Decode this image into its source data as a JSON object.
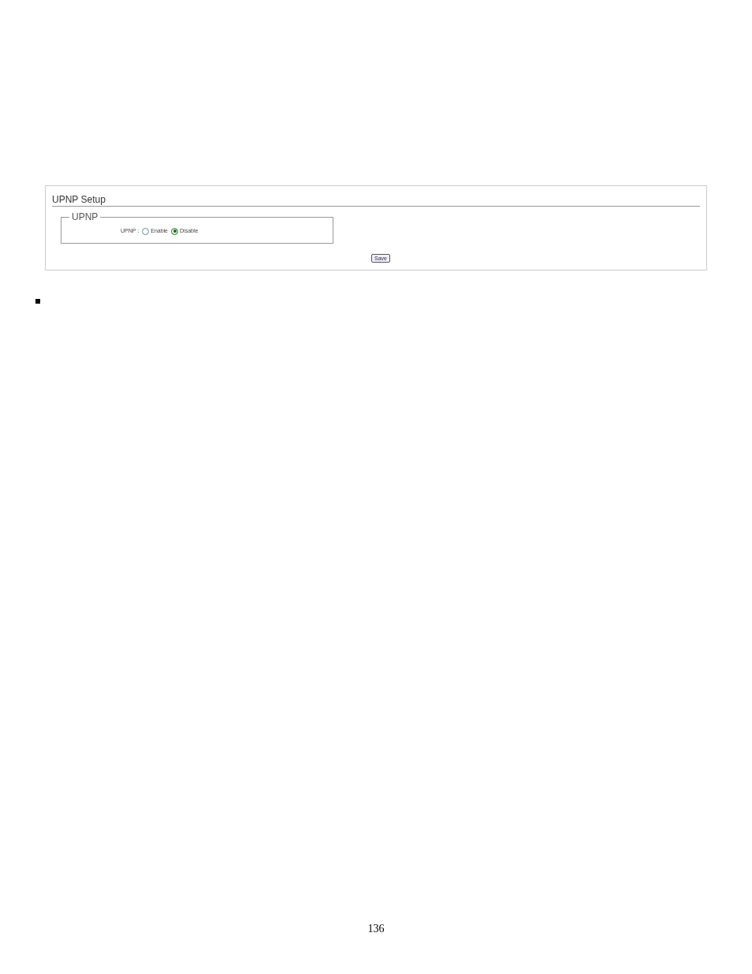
{
  "panel": {
    "title": "UPNP Setup",
    "group": {
      "legend": "UPNP",
      "field_label": "UPNP :",
      "options": [
        {
          "label": "Enable",
          "selected": false
        },
        {
          "label": "Disable",
          "selected": true
        }
      ]
    },
    "save_button": "Save"
  },
  "page_number": "136"
}
